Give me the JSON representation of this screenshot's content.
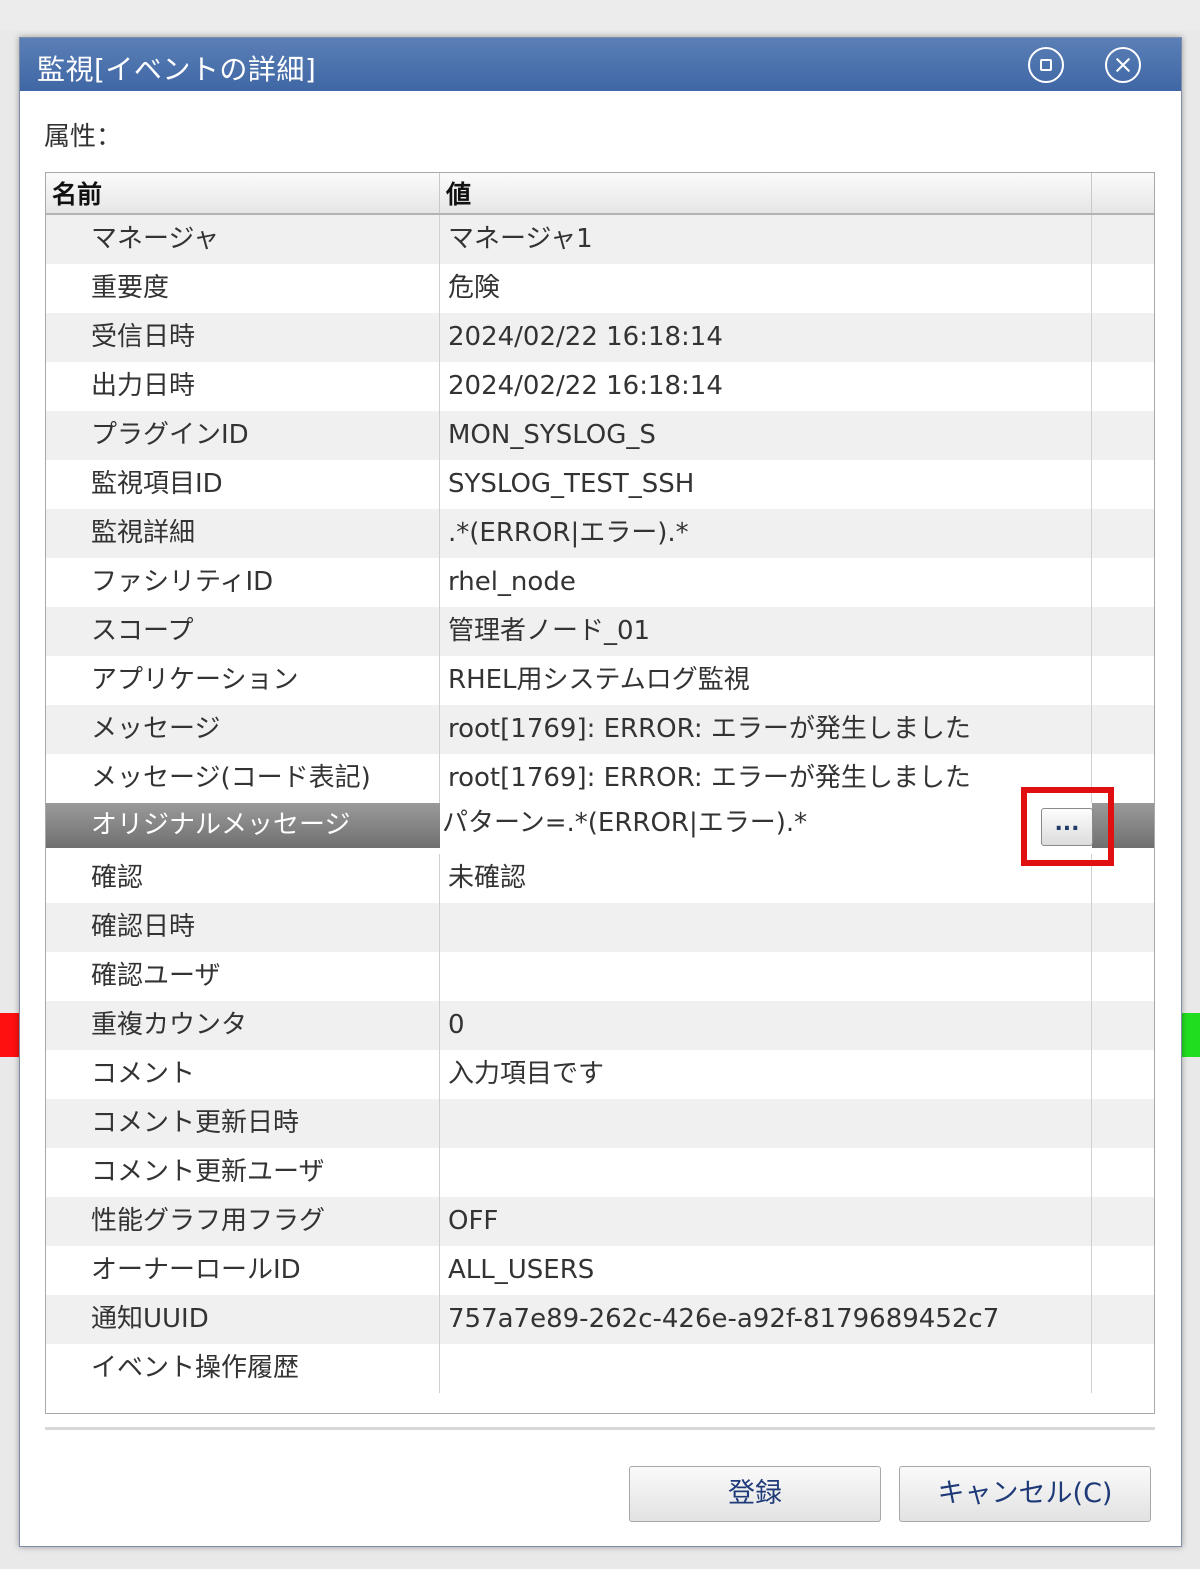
{
  "dialog": {
    "title": "監視[イベントの詳細]",
    "attributes_label": "属性：",
    "maximize_icon": "maximize-icon",
    "close_icon": "close-icon"
  },
  "table": {
    "columns": [
      "名前",
      "値",
      ""
    ],
    "rows": [
      {
        "name": "マネージャ",
        "value": "マネージャ1"
      },
      {
        "name": "重要度",
        "value": "危険"
      },
      {
        "name": "受信日時",
        "value": "2024/02/22 16:18:14"
      },
      {
        "name": "出力日時",
        "value": "2024/02/22 16:18:14"
      },
      {
        "name": "プラグインID",
        "value": "MON_SYSLOG_S"
      },
      {
        "name": "監視項目ID",
        "value": "SYSLOG_TEST_SSH"
      },
      {
        "name": "監視詳細",
        "value": ".*(ERROR|エラー).*"
      },
      {
        "name": "ファシリティID",
        "value": "rhel_node"
      },
      {
        "name": "スコープ",
        "value": "管理者ノード_01"
      },
      {
        "name": "アプリケーション",
        "value": "RHEL用システムログ監視"
      },
      {
        "name": "メッセージ",
        "value": "root[1769]: ERROR: エラーが発生しました"
      },
      {
        "name": "メッセージ(コード表記)",
        "value": "root[1769]: ERROR: エラーが発生しました"
      },
      {
        "name": "オリジナルメッセージ",
        "value": "パターン=.*(ERROR|エラー).*",
        "button_label": "..."
      },
      {
        "name": "確認",
        "value": "未確認"
      },
      {
        "name": "確認日時",
        "value": ""
      },
      {
        "name": "確認ユーザ",
        "value": ""
      },
      {
        "name": "重複カウンタ",
        "value": "0"
      },
      {
        "name": "コメント",
        "value": "入力項目です"
      },
      {
        "name": "コメント更新日時",
        "value": ""
      },
      {
        "name": "コメント更新ユーザ",
        "value": ""
      },
      {
        "name": "性能グラフ用フラグ",
        "value": "OFF"
      },
      {
        "name": "オーナーロールID",
        "value": "ALL_USERS"
      },
      {
        "name": "通知UUID",
        "value": "757a7e89-262c-426e-a92f-8179689452c7"
      },
      {
        "name": "イベント操作履歴",
        "value": ""
      }
    ],
    "selected_row_index": 12
  },
  "buttons": {
    "register": "登録",
    "cancel": "キャンセル(C)"
  },
  "colors": {
    "titlebar": "#4a71ad",
    "highlight": "#e01010",
    "selected_row": "#808080"
  }
}
